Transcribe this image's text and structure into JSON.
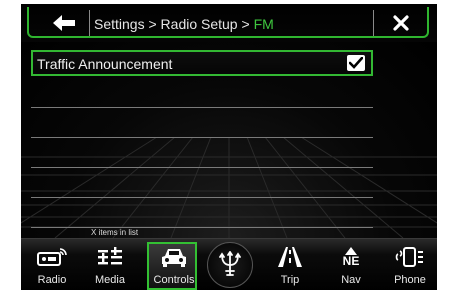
{
  "header": {
    "breadcrumb_prefix": "Settings > Radio Setup > ",
    "breadcrumb_current": "FM"
  },
  "list": {
    "items": [
      {
        "label": "Traffic Announcement",
        "checked": true
      }
    ],
    "count_text": "X items in list"
  },
  "nav": {
    "items": [
      {
        "label": "Radio",
        "icon": "radio-icon"
      },
      {
        "label": "Media",
        "icon": "media-icon"
      },
      {
        "label": "Controls",
        "icon": "car-icon",
        "active": true
      },
      {
        "label": "",
        "icon": "trident-logo-icon"
      },
      {
        "label": "Trip",
        "icon": "road-icon"
      },
      {
        "label": "Nav",
        "icon": "compass-icon",
        "heading": "NE"
      },
      {
        "label": "Phone",
        "icon": "phone-icon"
      }
    ]
  },
  "colors": {
    "accent": "#33b833",
    "background": "#000000",
    "text": "#f0f0f0"
  }
}
